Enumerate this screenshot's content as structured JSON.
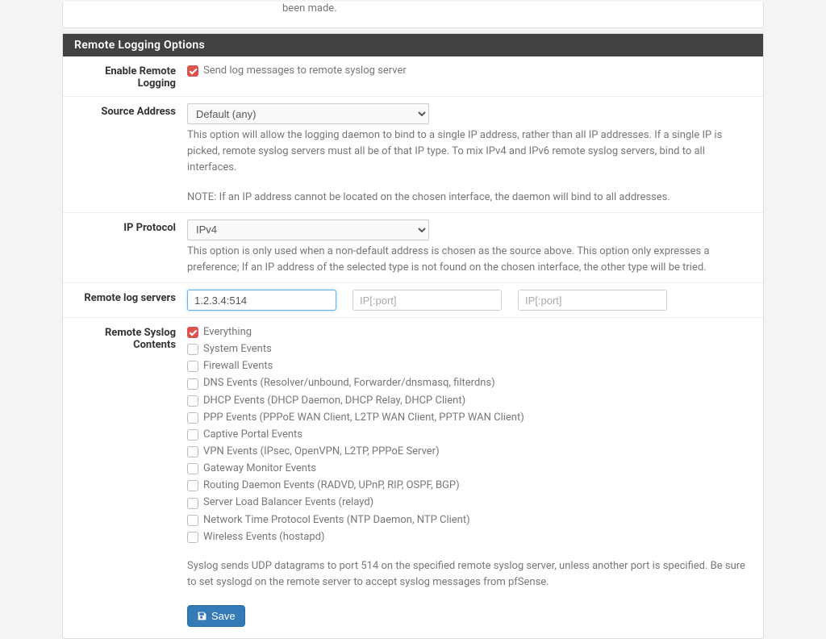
{
  "topFragment": "been made.",
  "panelTitle": "Remote Logging Options",
  "rows": {
    "enable": {
      "label": "Enable Remote Logging",
      "checkLabel": "Send log messages to remote syslog server",
      "checked": true
    },
    "sourceAddr": {
      "label": "Source Address",
      "selected": "Default (any)",
      "help1": "This option will allow the logging daemon to bind to a single IP address, rather than all IP addresses. If a single IP is picked, remote syslog servers must all be of that IP type. To mix IPv4 and IPv6 remote syslog servers, bind to all interfaces.",
      "help2": "NOTE: If an IP address cannot be located on the chosen interface, the daemon will bind to all addresses."
    },
    "ipProto": {
      "label": "IP Protocol",
      "selected": "IPv4",
      "help": "This option is only used when a non-default address is chosen as the source above. This option only expresses a preference; If an IP address of the selected type is not found on the chosen interface, the other type will be tried."
    },
    "servers": {
      "label": "Remote log servers",
      "s1": "1.2.3.4:514",
      "s2": "",
      "s3": "",
      "placeholder": "IP[:port]"
    },
    "contents": {
      "label": "Remote Syslog Contents",
      "items": [
        {
          "label": "Everything",
          "checked": true
        },
        {
          "label": "System Events",
          "checked": false
        },
        {
          "label": "Firewall Events",
          "checked": false
        },
        {
          "label": "DNS Events (Resolver/unbound, Forwarder/dnsmasq, filterdns)",
          "checked": false
        },
        {
          "label": "DHCP Events (DHCP Daemon, DHCP Relay, DHCP Client)",
          "checked": false
        },
        {
          "label": "PPP Events (PPPoE WAN Client, L2TP WAN Client, PPTP WAN Client)",
          "checked": false
        },
        {
          "label": "Captive Portal Events",
          "checked": false
        },
        {
          "label": "VPN Events (IPsec, OpenVPN, L2TP, PPPoE Server)",
          "checked": false
        },
        {
          "label": "Gateway Monitor Events",
          "checked": false
        },
        {
          "label": "Routing Daemon Events (RADVD, UPnP, RIP, OSPF, BGP)",
          "checked": false
        },
        {
          "label": "Server Load Balancer Events (relayd)",
          "checked": false
        },
        {
          "label": "Network Time Protocol Events (NTP Daemon, NTP Client)",
          "checked": false
        },
        {
          "label": "Wireless Events (hostapd)",
          "checked": false
        }
      ],
      "help": "Syslog sends UDP datagrams to port 514 on the specified remote syslog server, unless another port is specified. Be sure to set syslogd on the remote server to accept syslog messages from pfSense."
    }
  },
  "saveLabel": "Save"
}
